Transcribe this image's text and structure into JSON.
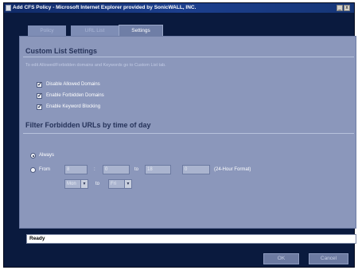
{
  "window": {
    "title": "Add CFS Policy - Microsoft Internet Explorer provided by SonicWALL, INC.",
    "min_glyph": "_",
    "close_glyph": "x"
  },
  "tabs": [
    {
      "label": "Policy",
      "active": false
    },
    {
      "label": "URL List",
      "active": false
    },
    {
      "label": "Settings",
      "active": true
    }
  ],
  "custom_list": {
    "heading": "Custom List Settings",
    "info": "To edit Allowed/Forbidden domains and Keywords go to Custom List tab.",
    "options": [
      {
        "label": "Disable Allowed Domains",
        "checked": true
      },
      {
        "label": "Enable Forbidden Domains",
        "checked": true
      },
      {
        "label": "Enable Keyword Blocking",
        "checked": true
      }
    ]
  },
  "filter": {
    "heading": "Filter Forbidden URLs by time of day",
    "always_label": "Always",
    "always_selected": true,
    "from_label": "From",
    "from_selected": false,
    "from_hour": "8",
    "from_min": "0",
    "colon": ":",
    "to_label": "to",
    "to_hour": "18",
    "to_min": "0",
    "format_label": "(24-Hour Format)",
    "day_from": "Mon",
    "day_to": "Fri",
    "day_to_label": "to",
    "arrow_glyph": "▼",
    "check_glyph": "✓"
  },
  "status": {
    "text": "Ready"
  },
  "buttons": {
    "ok": "OK",
    "cancel": "Cancel"
  },
  "colors": {
    "window_bg": "#0a1a3e",
    "panel_bg": "#8b97bb",
    "heading": "#26335a",
    "titlebar": "#1c3f8e"
  }
}
